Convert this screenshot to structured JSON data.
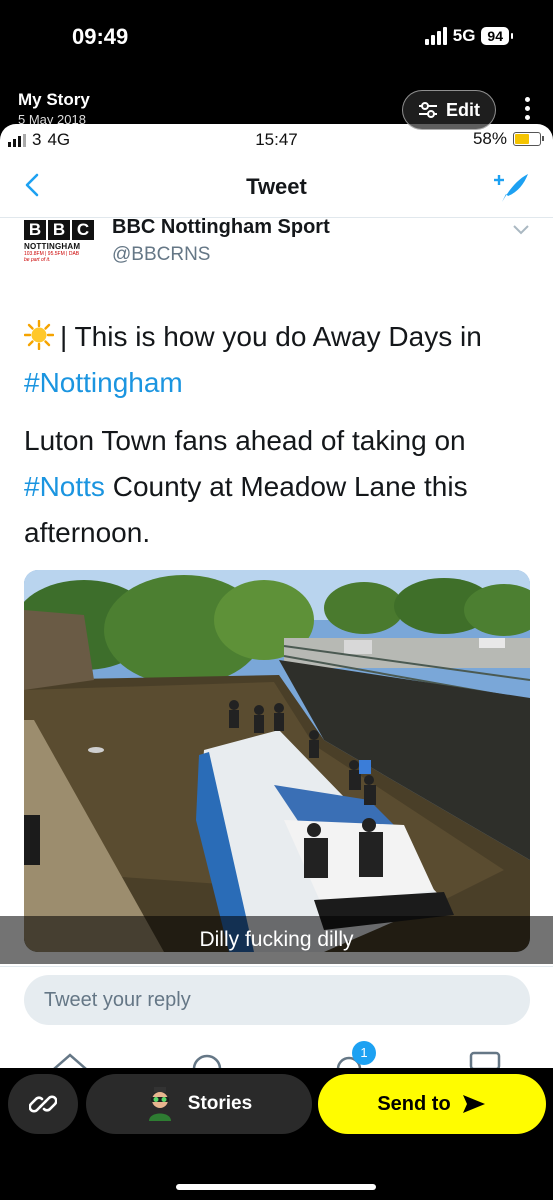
{
  "outer_status": {
    "time": "09:49",
    "network": "5G",
    "battery": "94"
  },
  "story": {
    "title": "My Story",
    "date": "5 May 2018",
    "edit_label": "Edit"
  },
  "inner_status": {
    "carrier": "3",
    "network": "4G",
    "time": "15:47",
    "battery": "58%"
  },
  "tweet_header": {
    "title": "Tweet"
  },
  "account": {
    "logo_letters": [
      "B",
      "B",
      "C"
    ],
    "logo_sub": "NOTTINGHAM",
    "logo_freq": "103.8FM | 95.5FM | DAB",
    "logo_tag": "be part of it.",
    "name": "BBC Nottingham Sport",
    "handle": "@BBCRNS"
  },
  "tweet": {
    "line1_text": "| This is how you do Away Days in",
    "line1_tag": "#Nottingham",
    "line2_pre": "Luton Town fans ahead of taking on",
    "line2_tag": "#Notts",
    "line2_post": "County at Meadow Lane this afternoon."
  },
  "caption": "Dilly fucking dilly",
  "reply": {
    "placeholder": "Tweet your reply",
    "badge": "1"
  },
  "bottom": {
    "stories_label": "Stories",
    "send_label": "Send to"
  },
  "colors": {
    "twitter_blue": "#1b95e0",
    "snap_yellow": "#fffc00"
  }
}
